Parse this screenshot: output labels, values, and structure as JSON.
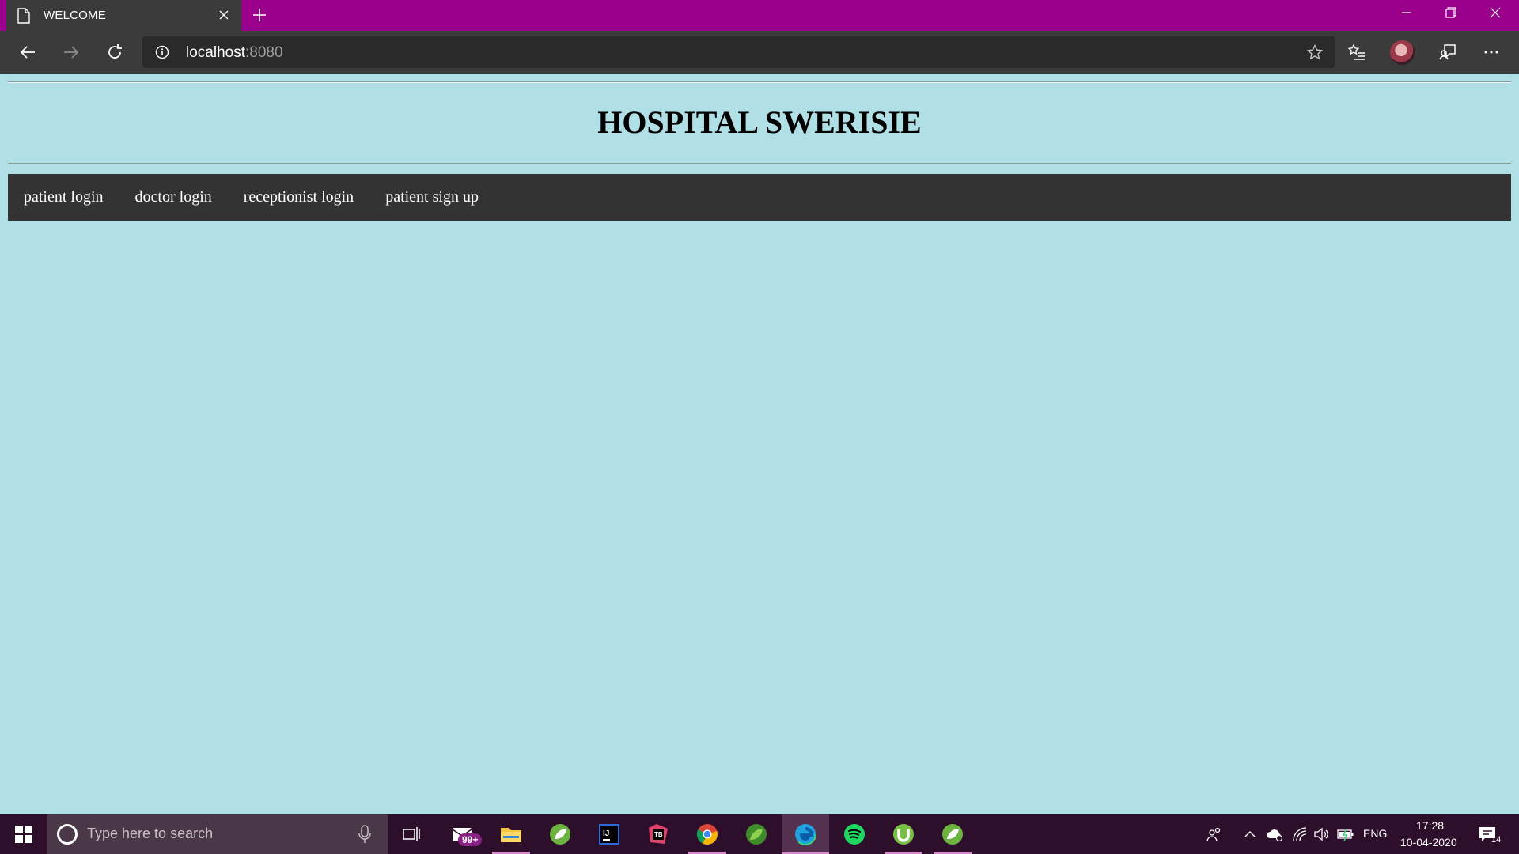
{
  "browser": {
    "tab_title": "WELCOME",
    "url_host": "localhost",
    "url_port": ":8080"
  },
  "page": {
    "title": "HOSPITAL SWERISIE",
    "nav": [
      {
        "label": "patient login"
      },
      {
        "label": "doctor login"
      },
      {
        "label": "receptionist login"
      },
      {
        "label": "patient sign up"
      }
    ]
  },
  "taskbar": {
    "search_placeholder": "Type here to search",
    "mail_badge": "99+",
    "language": "ENG",
    "time": "17:28",
    "date": "10-04-2020",
    "notification_count": "14",
    "apps": [
      {
        "name": "mail-app-icon",
        "color": "#ffffff"
      },
      {
        "name": "file-explorer-icon",
        "color": "#f4c542"
      },
      {
        "name": "spring-tools-icon",
        "color": "#6db33f"
      },
      {
        "name": "intellij-icon",
        "color": "#ffffff"
      },
      {
        "name": "jetbrains-toolbox-icon",
        "color": "#e0426b"
      },
      {
        "name": "chrome-icon",
        "color": "#4285f4"
      },
      {
        "name": "spring-tools-alt-icon",
        "color": "#6db33f"
      },
      {
        "name": "edge-icon",
        "color": "#1fa3e0"
      },
      {
        "name": "spotify-icon",
        "color": "#1ed760"
      },
      {
        "name": "utorrent-icon",
        "color": "#78c043"
      },
      {
        "name": "spring-boot-icon",
        "color": "#6db33f"
      }
    ]
  },
  "colors": {
    "titlebar": "#9b008d",
    "page_background": "#b0dfe5",
    "nav_background": "#333333",
    "taskbar": "#2e0f2b"
  }
}
